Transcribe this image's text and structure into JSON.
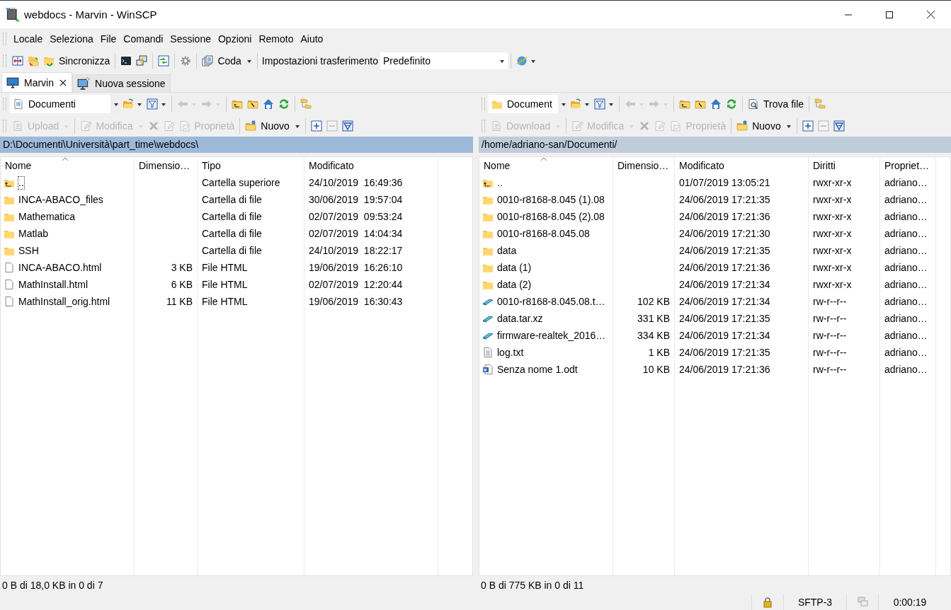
{
  "window": {
    "title": "webdocs - Marvin - WinSCP"
  },
  "menu": [
    "Locale",
    "Seleziona",
    "File",
    "Comandi",
    "Sessione",
    "Opzioni",
    "Remoto",
    "Aiuto"
  ],
  "toolbar": {
    "sync_label": "Sincronizza",
    "queue_label": "Coda",
    "transfer_label": "Impostazioni trasferimento",
    "transfer_preset": "Predefinito"
  },
  "tabs": [
    {
      "label": "Marvin",
      "selected": true,
      "closable": true
    },
    {
      "label": "Nuova sessione",
      "selected": false,
      "closable": false
    }
  ],
  "panels": [
    {
      "kind": "local",
      "active": true,
      "location": "Documenti",
      "back_disabled": true,
      "forward_disabled": true,
      "transfer_button": {
        "label": "Upload",
        "disabled": true
      },
      "edit_button": {
        "label": "Modifica",
        "disabled": true
      },
      "delete_disabled": true,
      "rename_disabled": true,
      "properties_button": {
        "label": "Proprietà",
        "disabled": true
      },
      "new_button": {
        "label": "Nuovo",
        "disabled": false
      },
      "collapse_disabled": true,
      "path": "D:\\Documenti\\Università\\part_time\\webdocs\\",
      "columns": [
        {
          "label": "Nome",
          "sorted": true
        },
        {
          "label": "Dimensio…",
          "sorted": false
        },
        {
          "label": "Tipo",
          "sorted": false
        },
        {
          "label": "Modificato",
          "sorted": false
        }
      ],
      "rows": [
        {
          "kind": "parent",
          "focused": true,
          "cells": [
            "..",
            "",
            "Cartella superiore",
            "24/10/2019  16:49:36"
          ]
        },
        {
          "kind": "folder",
          "focused": false,
          "cells": [
            "INCA-ABACO_files",
            "",
            "Cartella di file",
            "30/06/2019  19:57:04"
          ]
        },
        {
          "kind": "folder",
          "focused": false,
          "cells": [
            "Mathematica",
            "",
            "Cartella di file",
            "02/07/2019  09:53:24"
          ]
        },
        {
          "kind": "folder",
          "focused": false,
          "cells": [
            "Matlab",
            "",
            "Cartella di file",
            "02/07/2019  14:04:34"
          ]
        },
        {
          "kind": "folder",
          "focused": false,
          "cells": [
            "SSH",
            "",
            "Cartella di file",
            "24/10/2019  18:22:17"
          ]
        },
        {
          "kind": "file",
          "focused": false,
          "cells": [
            "INCA-ABACO.html",
            "3 KB",
            "File HTML",
            "19/06/2019  16:26:10"
          ]
        },
        {
          "kind": "file",
          "focused": false,
          "cells": [
            "MathInstall.html",
            "6 KB",
            "File HTML",
            "02/07/2019  12:20:44"
          ]
        },
        {
          "kind": "file",
          "focused": false,
          "cells": [
            "MathInstall_orig.html",
            "11 KB",
            "File HTML",
            "19/06/2019  16:30:43"
          ]
        }
      ],
      "status": "0 B di 18,0 KB in 0 di 7"
    },
    {
      "kind": "remote",
      "active": false,
      "location": "Document",
      "find_label": "Trova file",
      "back_disabled": true,
      "forward_disabled": true,
      "transfer_button": {
        "label": "Download",
        "disabled": true
      },
      "edit_button": {
        "label": "Modifica",
        "disabled": true
      },
      "delete_disabled": true,
      "rename_disabled": true,
      "properties_button": {
        "label": "Proprietà",
        "disabled": true
      },
      "new_button": {
        "label": "Nuovo",
        "disabled": false
      },
      "collapse_disabled": true,
      "path": "/home/adriano-san/Documenti/",
      "columns": [
        {
          "label": "Nome",
          "sorted": true
        },
        {
          "label": "Dimensio…",
          "sorted": false
        },
        {
          "label": "Modificato",
          "sorted": false
        },
        {
          "label": "Diritti",
          "sorted": false
        },
        {
          "label": "Propriet…",
          "sorted": false
        }
      ],
      "rows": [
        {
          "kind": "parent",
          "focused": false,
          "cells": [
            "..",
            "",
            "01/07/2019 13:05:21",
            "rwxr-xr-x",
            "adriano…"
          ]
        },
        {
          "kind": "folder",
          "focused": false,
          "cells": [
            "0010-r8168-8.045 (1).08",
            "",
            "24/06/2019 17:21:35",
            "rwxr-xr-x",
            "adriano…"
          ]
        },
        {
          "kind": "folder",
          "focused": false,
          "cells": [
            "0010-r8168-8.045 (2).08",
            "",
            "24/06/2019 17:21:36",
            "rwxr-xr-x",
            "adriano…"
          ]
        },
        {
          "kind": "folder",
          "focused": false,
          "cells": [
            "0010-r8168-8.045.08",
            "",
            "24/06/2019 17:21:30",
            "rwxr-xr-x",
            "adriano…"
          ]
        },
        {
          "kind": "folder",
          "focused": false,
          "cells": [
            "data",
            "",
            "24/06/2019 17:21:35",
            "rwxr-xr-x",
            "adriano…"
          ]
        },
        {
          "kind": "folder",
          "focused": false,
          "cells": [
            "data (1)",
            "",
            "24/06/2019 17:21:36",
            "rwxr-xr-x",
            "adriano…"
          ]
        },
        {
          "kind": "folder",
          "focused": false,
          "cells": [
            "data (2)",
            "",
            "24/06/2019 17:21:34",
            "rwxr-xr-x",
            "adriano…"
          ]
        },
        {
          "kind": "archive",
          "focused": false,
          "cells": [
            "0010-r8168-8.045.08.t…",
            "102 KB",
            "24/06/2019 17:21:34",
            "rw-r--r--",
            "adriano…"
          ]
        },
        {
          "kind": "archive",
          "focused": false,
          "cells": [
            "data.tar.xz",
            "331 KB",
            "24/06/2019 17:21:35",
            "rw-r--r--",
            "adriano…"
          ]
        },
        {
          "kind": "archive",
          "focused": false,
          "cells": [
            "firmware-realtek_2016…",
            "334 KB",
            "24/06/2019 17:21:34",
            "rw-r--r--",
            "adriano…"
          ]
        },
        {
          "kind": "text",
          "focused": false,
          "cells": [
            "log.txt",
            "1 KB",
            "24/06/2019 17:21:35",
            "rw-r--r--",
            "adriano…"
          ]
        },
        {
          "kind": "document",
          "focused": false,
          "cells": [
            "Senza nome 1.odt",
            "10 KB",
            "24/06/2019 17:21:36",
            "rw-r--r--",
            "adriano…"
          ]
        }
      ],
      "status": "0 B di 775 KB in 0 di 11"
    }
  ],
  "status_bar": {
    "protocol": "SFTP-3",
    "elapsed": "0:00:19"
  }
}
